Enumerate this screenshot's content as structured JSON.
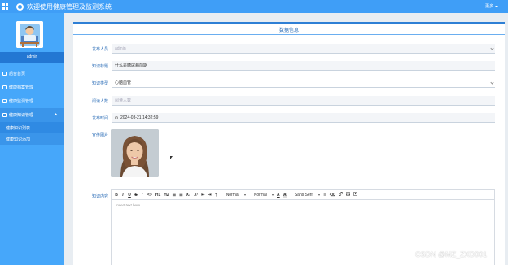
{
  "header": {
    "title": "欢迎使用健康管理及监测系统",
    "user_menu": "更多"
  },
  "sidebar": {
    "user_name": "admin",
    "items": [
      {
        "label": "后台首页"
      },
      {
        "label": "健康档案管理"
      },
      {
        "label": "健康监测管理"
      },
      {
        "label": "健康知识管理"
      }
    ],
    "sub_items": [
      {
        "label": "健康知识列表"
      },
      {
        "label": "健康知识添加"
      }
    ]
  },
  "panel": {
    "title": "数据信息",
    "fields": [
      {
        "label": "发布人员",
        "value": "admin",
        "placeholder": true
      },
      {
        "label": "知识标题",
        "value": "什么是糖尿病前期"
      },
      {
        "label": "知识类型",
        "value": "心脑血管"
      },
      {
        "label": "阅读人数",
        "value": "阅读人数",
        "placeholder": true
      },
      {
        "label": "发布时间",
        "value": "2024-03-21 14:32:59"
      },
      {
        "label": "宣传图片",
        "value": ""
      },
      {
        "label": "知识内容",
        "value": ""
      }
    ]
  },
  "editor": {
    "toolbar": {
      "bold": "B",
      "italic": "I",
      "underline": "U",
      "strike": "S",
      "quote": "\"",
      "code": "<>",
      "h1": "H1",
      "h2": "H2",
      "ol": "☰",
      "ul": "☰",
      "sub": "X₂",
      "sup": "X²",
      "indent_left": "⇤",
      "indent_right": "⇥",
      "direction": "¶",
      "size_label": "Normal",
      "header_label": "Normal",
      "color": "A",
      "background": "A",
      "font_label": "Sans Serif",
      "align": "≡",
      "link": "🔗",
      "image": "▣",
      "video": "▤"
    },
    "placeholder": "Insert text here ..."
  },
  "watermark": "CSDN @MZ_ZXD001",
  "colors": {
    "topbar": "#3f9ef7",
    "sidebar": "#46a7fa",
    "accent": "#2e7fd5"
  }
}
